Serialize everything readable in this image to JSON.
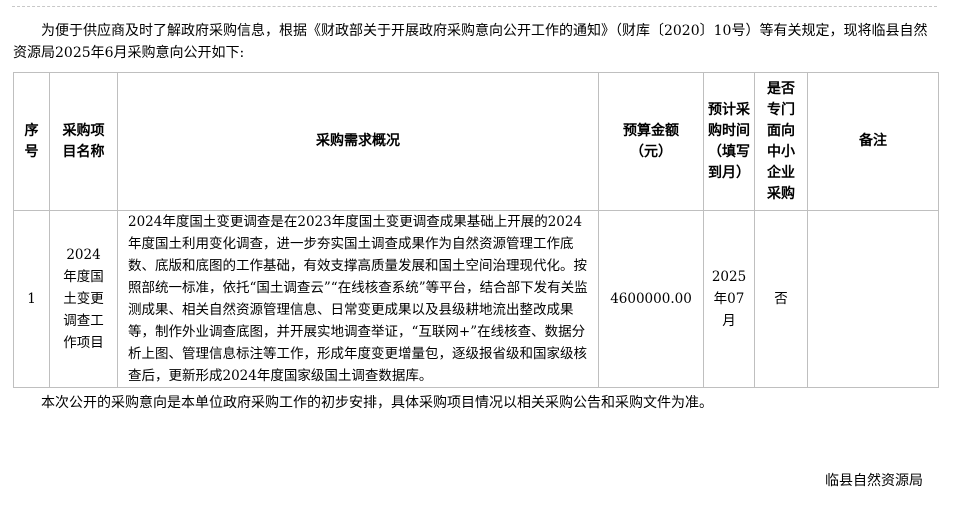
{
  "intro": "为便于供应商及时了解政府采购信息，根据《财政部关于开展政府采购意向公开工作的通知》（财库〔2020〕10号）等有关规定，现将临县自然资源局2025年6月采购意向公开如下:",
  "table": {
    "headers": {
      "seq": "序号",
      "item_name": "采购项目名称",
      "requirements": "采购需求概况",
      "budget": "预算金额（元）",
      "time": "预计采购时间（填写到月）",
      "sme": "是否专门面向中小企业采购",
      "remarks": "备注"
    },
    "rows": [
      {
        "seq": "1",
        "item_name": "2024年度国土变更调查工作项目",
        "requirements": "2024年度国土变更调查是在2023年度国土变更调查成果基础上开展的2024年度国土利用变化调查，进一步夯实国土调查成果作为自然资源管理工作底数、底版和底图的工作基础，有效支撑高质量发展和国土空间治理现代化。按照部统一标准，依托“国土调查云”“在线核查系统”等平台，结合部下发有关监测成果、相关自然资源管理信息、日常变更成果以及县级耕地流出整改成果等，制作外业调查底图，并开展实地调查举证，“互联网+”在线核查、数据分析上图、管理信息标注等工作，形成年度变更增量包，逐级报省级和国家级核查后，更新形成2024年度国家级国土调查数据库。",
        "budget": "4600000.00",
        "time": "2025年07月",
        "sme": "否",
        "remarks": ""
      }
    ]
  },
  "note": "本次公开的采购意向是本单位政府采购工作的初步安排，具体采购项目情况以相关采购公告和采购文件为准。",
  "signature": "临县自然资源局"
}
